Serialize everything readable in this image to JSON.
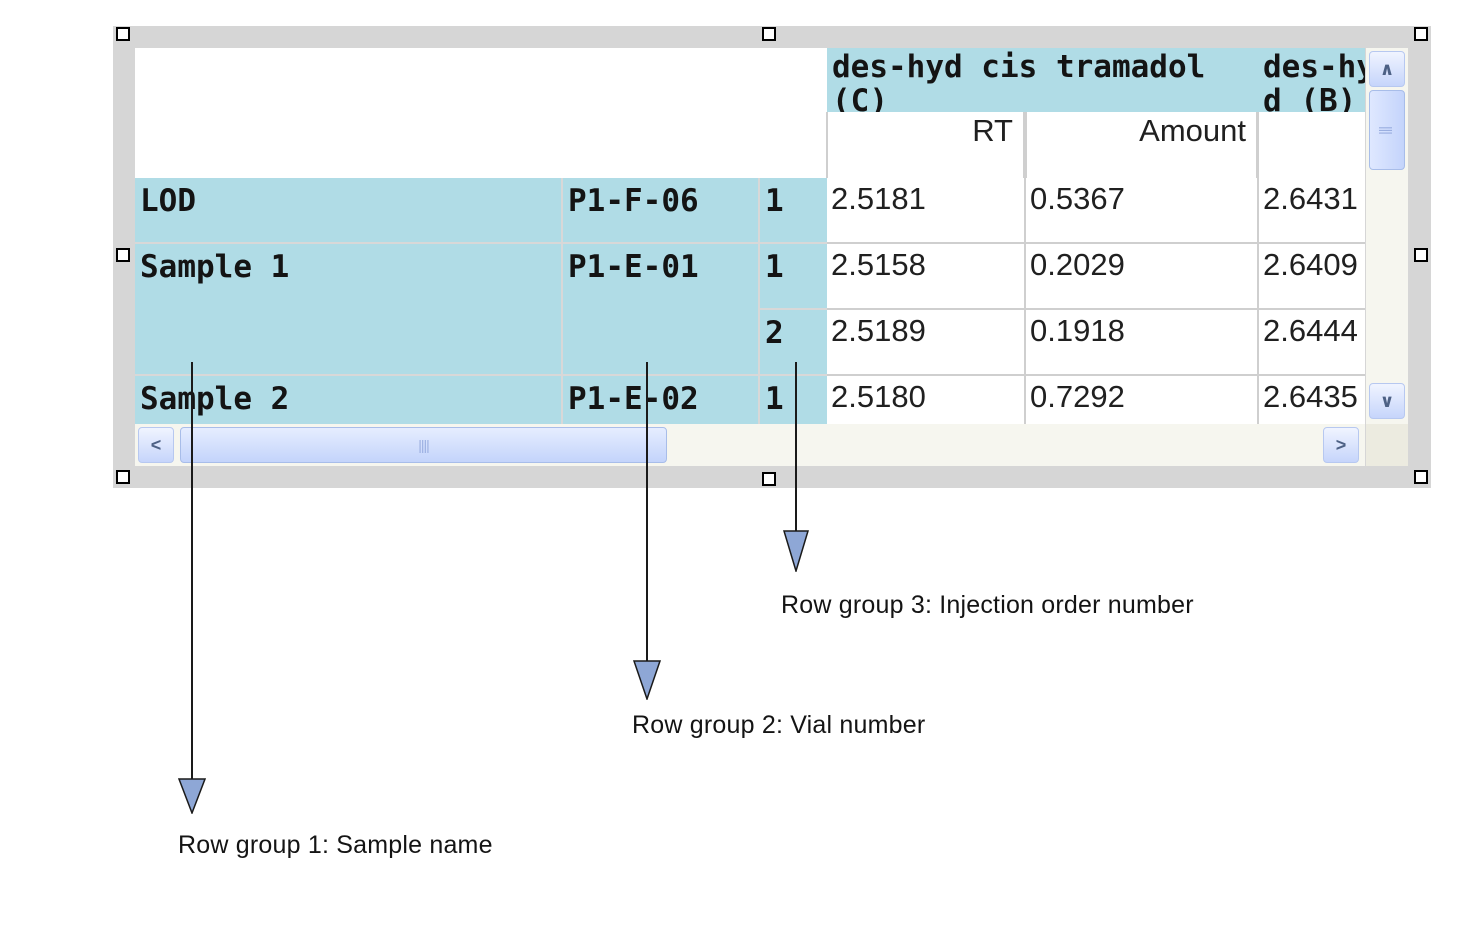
{
  "table": {
    "compounds": [
      {
        "name": "des-hyd cis tramadol (C)",
        "col_labels": [
          "RT",
          "Amount"
        ]
      },
      {
        "name": "des-hyd (B)",
        "col_labels": [
          ""
        ]
      }
    ],
    "rows": [
      {
        "sample": "LOD",
        "vial": "P1-F-06",
        "injection": "1",
        "values": [
          "2.5181",
          "0.5367",
          "2.6431"
        ]
      },
      {
        "sample": "Sample 1",
        "vial": "P1-E-01",
        "injection": "1",
        "values": [
          "2.5158",
          "0.2029",
          "2.6409"
        ]
      },
      {
        "sample": "",
        "vial": "",
        "injection": "2",
        "values": [
          "2.5189",
          "0.1918",
          "2.6444"
        ]
      },
      {
        "sample": "Sample 2",
        "vial": "P1-E-02",
        "injection": "1",
        "values": [
          "2.5180",
          "0.7292",
          "2.6435"
        ]
      }
    ]
  },
  "scrollbars": {
    "vertical": {
      "up_icon": "chevron-up-icon",
      "down_icon": "chevron-down-icon"
    },
    "horizontal": {
      "left_icon": "chevron-left-icon",
      "right_icon": "chevron-right-icon"
    }
  },
  "annotations": {
    "group1": "Row group 1: Sample name",
    "group2": "Row group 2: Vial number",
    "group3": "Row group 3: Injection order number"
  },
  "colors": {
    "header_bg": "#b0dce6",
    "frame": "#d6d6d6",
    "scroll_button": "#c6d5fb",
    "arrow_fill": "#8ea7d6"
  }
}
